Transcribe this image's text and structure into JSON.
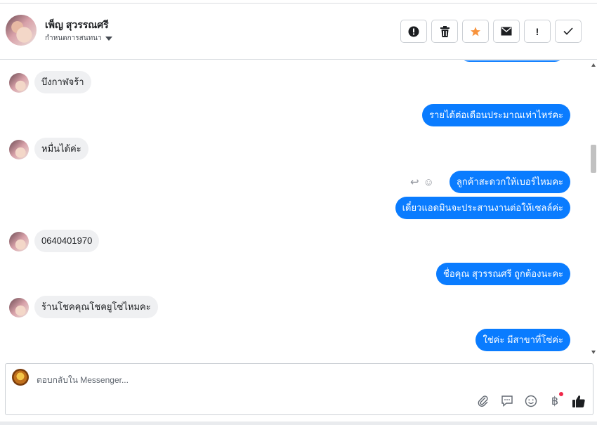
{
  "header": {
    "name": "เพ็ญ สุวรรณศรี",
    "subtitle": "กำหนดการสนทนา"
  },
  "actions": [
    {
      "name": "report-button",
      "glyph": "❗"
    },
    {
      "name": "delete-button",
      "glyph": "🗑"
    },
    {
      "name": "star-button",
      "glyph": "★"
    },
    {
      "name": "mark-unread-button",
      "glyph": "✉"
    },
    {
      "name": "spam-button",
      "glyph": "!"
    },
    {
      "name": "done-button",
      "glyph": "✓"
    }
  ],
  "messages": {
    "m1": "บึงกาฬจร้า",
    "m2": "รายได้ต่อเดือนประมาณเท่าไหร่คะ",
    "m3": "หมื่นได้ค่ะ",
    "m4": "ลูกค้าสะดวกให้เบอร์ไหมคะ",
    "m5": "เดี๋ยวแอดมินจะประสานงานต่อให้เซลล์ค่ะ",
    "m6": "0640401970",
    "m7": "ชื่อคุณ สุวรรณศรี ถูกต้องนะคะ",
    "m8": "ร้านโชคคุณโชคยูโซ่ไหมคะ",
    "m9": "ใช่ค่ะ มีสาขาที่โซ่ค่ะ"
  },
  "composer": {
    "placeholder": "ตอบกลับใน Messenger..."
  },
  "colors": {
    "outgoing": "#0a7cff",
    "incoming": "#eff0f2",
    "star": "#f7923b"
  }
}
